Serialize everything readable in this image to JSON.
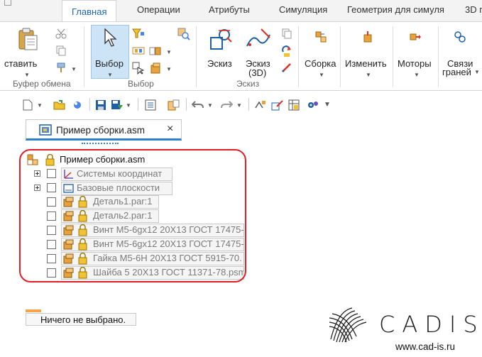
{
  "ribbon_tabs": [
    {
      "label": "Главная",
      "active": true
    },
    {
      "label": "Операции",
      "active": false
    },
    {
      "label": "Атрибуты",
      "active": false
    },
    {
      "label": "Симуляция",
      "active": false
    },
    {
      "label": "Геометрия для симуля",
      "active": false
    },
    {
      "label": "3D п",
      "active": false
    }
  ],
  "ribbon": {
    "paste_label": "ставить",
    "clipboard_group": "Буфер обмена",
    "select_label": "Выбор",
    "select_group": "Выбор",
    "sketch_label": "Эскиз",
    "sketch3d_label_1": "Эскиз",
    "sketch3d_label_2": "(3D)",
    "sketch_group": "Эскиз",
    "assembly_label": "Сборка",
    "modify_label": "Изменить",
    "motors_label": "Моторы",
    "face_links_label_1": "Связи",
    "face_links_label_2": "граней"
  },
  "document_tab": {
    "title": "Пример сборки.asm",
    "close": "×"
  },
  "tree": {
    "root": "Пример сборки.asm",
    "nodes": [
      {
        "label": "Системы координат",
        "expandable": true
      },
      {
        "label": "Базовые плоскости",
        "expandable": true
      },
      {
        "label": "Деталь1.par:1",
        "expandable": false
      },
      {
        "label": "Деталь2.par:1",
        "expandable": false
      },
      {
        "label": "Винт М5-6gx12 20Х13 ГОСТ 17475-",
        "expandable": false
      },
      {
        "label": "Винт М5-6gx12 20Х13 ГОСТ 17475-",
        "expandable": false
      },
      {
        "label": "Гайка М5-6Н 20Х13 ГОСТ 5915-70.",
        "expandable": false
      },
      {
        "label": "Шайба 5 20Х13 ГОСТ 11371-78.psm",
        "expandable": false
      }
    ]
  },
  "status": {
    "text": "Ничего не выбрано."
  },
  "branding": {
    "logo_text": "CADIS",
    "url": "www.cad-is.ru"
  },
  "colors": {
    "accent": "#1e66b4",
    "highlight_outline": "#e01f26",
    "selected_tool_bg": "#cde4f7"
  }
}
